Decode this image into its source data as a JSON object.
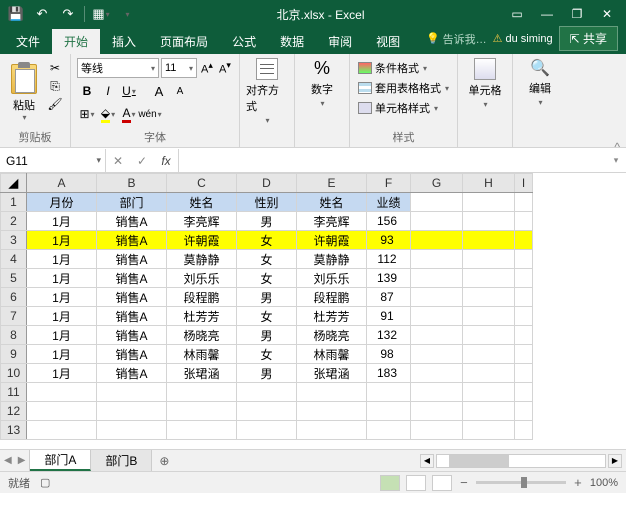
{
  "title": "北京.xlsx - Excel",
  "tabs": [
    "文件",
    "开始",
    "插入",
    "页面布局",
    "公式",
    "数据",
    "审阅",
    "视图"
  ],
  "active_tab": "开始",
  "tell_me": "告诉我…",
  "user": "du siming",
  "share": "共享",
  "ribbon": {
    "clipboard": {
      "paste": "粘贴",
      "label": "剪贴板"
    },
    "font": {
      "name": "等线",
      "size": "11",
      "label": "字体"
    },
    "alignment": {
      "label": "对齐方式"
    },
    "number": {
      "symbol": "%",
      "label": "数字"
    },
    "styles": {
      "cond": "条件格式",
      "table": "套用表格格式",
      "cell": "单元格样式",
      "label": "样式"
    },
    "cells": {
      "label": "单元格"
    },
    "editing": {
      "label": "编辑"
    }
  },
  "namebox": "G11",
  "columns": [
    "A",
    "B",
    "C",
    "D",
    "E",
    "F",
    "G",
    "H",
    "I"
  ],
  "headers": [
    "月份",
    "部门",
    "姓名",
    "性别",
    "姓名",
    "业绩"
  ],
  "rows": [
    {
      "n": 1,
      "hdr": true
    },
    {
      "n": 2,
      "d": [
        "1月",
        "销售A",
        "李亮辉",
        "男",
        "李亮辉",
        "156"
      ]
    },
    {
      "n": 3,
      "d": [
        "1月",
        "销售A",
        "许朝霞",
        "女",
        "许朝霞",
        "93"
      ],
      "hl": true
    },
    {
      "n": 4,
      "d": [
        "1月",
        "销售A",
        "莫静静",
        "女",
        "莫静静",
        "112"
      ]
    },
    {
      "n": 5,
      "d": [
        "1月",
        "销售A",
        "刘乐乐",
        "女",
        "刘乐乐",
        "139"
      ]
    },
    {
      "n": 6,
      "d": [
        "1月",
        "销售A",
        "段程鹏",
        "男",
        "段程鹏",
        "87"
      ]
    },
    {
      "n": 7,
      "d": [
        "1月",
        "销售A",
        "杜芳芳",
        "女",
        "杜芳芳",
        "91"
      ]
    },
    {
      "n": 8,
      "d": [
        "1月",
        "销售A",
        "杨晓亮",
        "男",
        "杨晓亮",
        "132"
      ]
    },
    {
      "n": 9,
      "d": [
        "1月",
        "销售A",
        "林雨馨",
        "女",
        "林雨馨",
        "98"
      ]
    },
    {
      "n": 10,
      "d": [
        "1月",
        "销售A",
        "张珺涵",
        "男",
        "张珺涵",
        "183"
      ]
    },
    {
      "n": 11,
      "d": [
        "",
        "",
        "",
        "",
        "",
        ""
      ]
    },
    {
      "n": 12,
      "d": [
        "",
        "",
        "",
        "",
        "",
        ""
      ]
    },
    {
      "n": 13,
      "d": [
        "",
        "",
        "",
        "",
        "",
        ""
      ]
    }
  ],
  "sheets": [
    "部门A",
    "部门B"
  ],
  "active_sheet": "部门A",
  "status": "就绪",
  "zoom": "100%",
  "chart_data": {
    "type": "table",
    "columns": [
      "月份",
      "部门",
      "姓名",
      "性别",
      "姓名",
      "业绩"
    ],
    "rows": [
      [
        "1月",
        "销售A",
        "李亮辉",
        "男",
        "李亮辉",
        156
      ],
      [
        "1月",
        "销售A",
        "许朝霞",
        "女",
        "许朝霞",
        93
      ],
      [
        "1月",
        "销售A",
        "莫静静",
        "女",
        "莫静静",
        112
      ],
      [
        "1月",
        "销售A",
        "刘乐乐",
        "女",
        "刘乐乐",
        139
      ],
      [
        "1月",
        "销售A",
        "段程鹏",
        "男",
        "段程鹏",
        87
      ],
      [
        "1月",
        "销售A",
        "杜芳芳",
        "女",
        "杜芳芳",
        91
      ],
      [
        "1月",
        "销售A",
        "杨晓亮",
        "男",
        "杨晓亮",
        132
      ],
      [
        "1月",
        "销售A",
        "林雨馨",
        "女",
        "林雨馨",
        98
      ],
      [
        "1月",
        "销售A",
        "张珺涵",
        "男",
        "张珺涵",
        183
      ]
    ]
  }
}
